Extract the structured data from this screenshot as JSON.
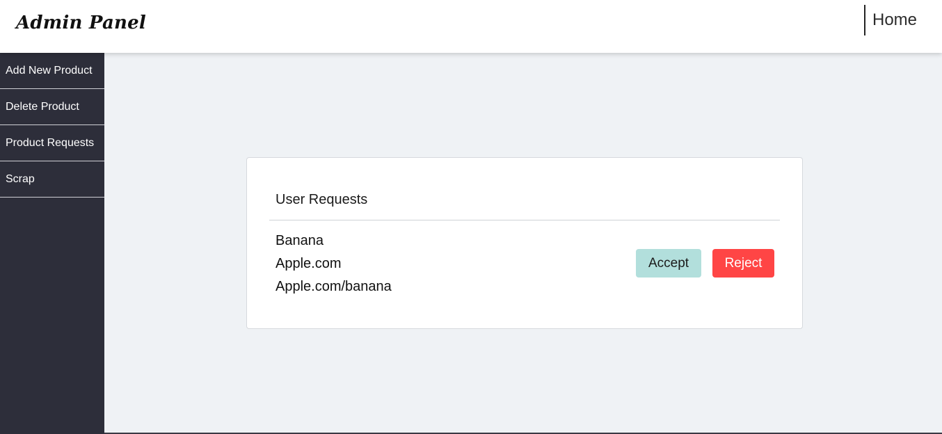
{
  "header": {
    "brand": "Admin Panel",
    "nav": {
      "home_label": "Home"
    }
  },
  "sidebar": {
    "items": [
      {
        "label": "Add New Product"
      },
      {
        "label": "Delete Product"
      },
      {
        "label": "Product Requests"
      },
      {
        "label": "Scrap"
      }
    ]
  },
  "main": {
    "card": {
      "title": "User Requests",
      "request": {
        "name": "Banana",
        "site": "Apple.com",
        "url": "Apple.com/banana"
      },
      "accept_label": "Accept",
      "reject_label": "Reject"
    }
  },
  "colors": {
    "sidebar_bg": "#2d2e3a",
    "main_bg": "#eff2f5",
    "accept_bg": "#b2dfdc",
    "reject_bg": "#ff4545"
  }
}
